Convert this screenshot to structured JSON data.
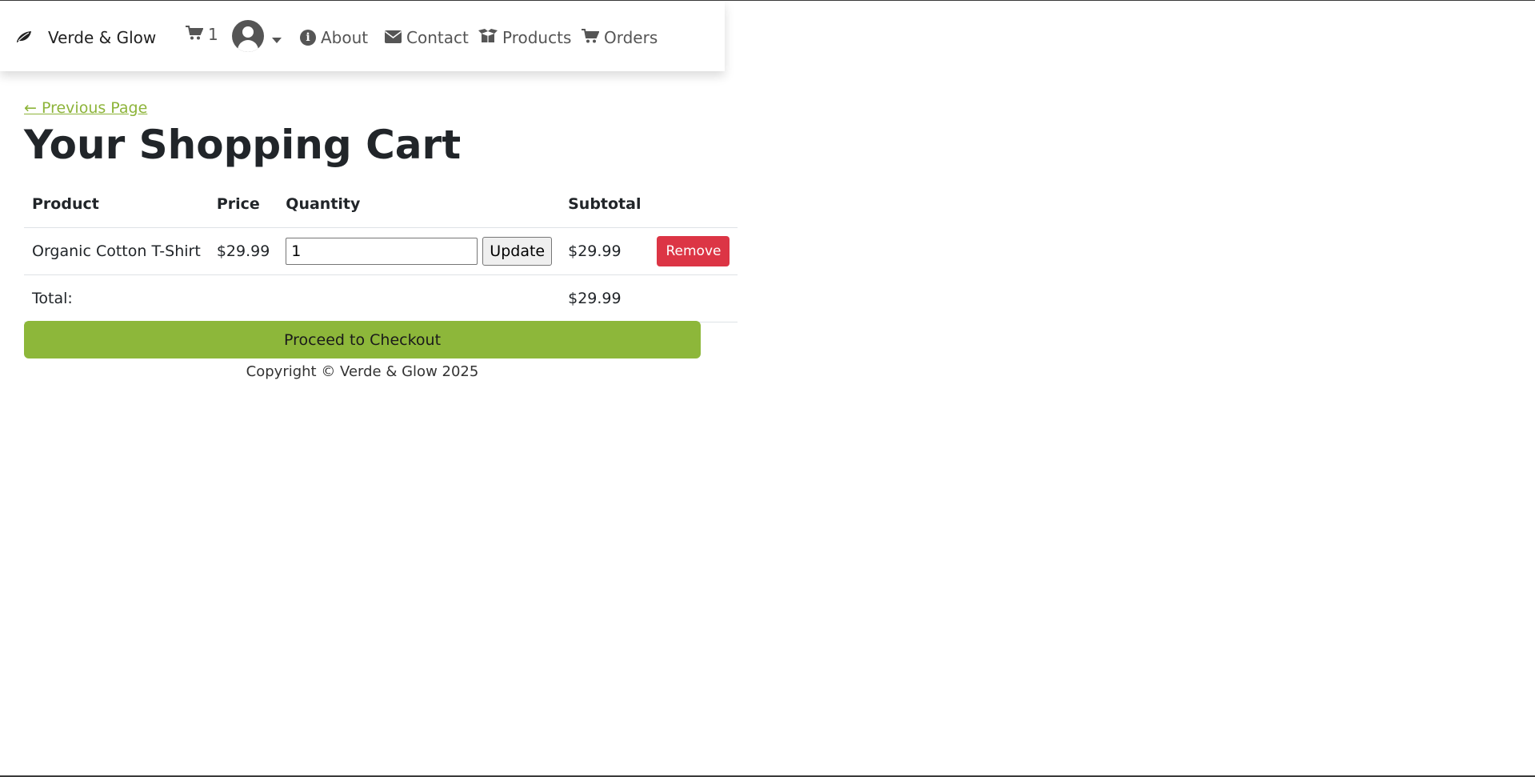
{
  "navbar": {
    "brand": "Verde & Glow",
    "cart_count": "1",
    "links": {
      "about": "About",
      "contact": "Contact",
      "products": "Products",
      "orders": "Orders"
    },
    "icons": {
      "brand": "leaf-icon",
      "cart": "cart-icon",
      "user": "user-avatar-icon",
      "about": "info-icon",
      "contact": "envelope-icon",
      "products": "box-open-icon",
      "orders": "cart-icon"
    }
  },
  "main": {
    "back_link": "← Previous Page",
    "title": "Your Shopping Cart",
    "table": {
      "headers": [
        "Product",
        "Price",
        "Quantity",
        "Subtotal",
        ""
      ],
      "rows": [
        {
          "product": "Organic Cotton T-Shirt",
          "price": "$29.99",
          "quantity": "1",
          "update_label": "Update",
          "subtotal": "$29.99",
          "remove_label": "Remove"
        }
      ],
      "total_label": "Total:",
      "total_value": "$29.99"
    },
    "checkout_label": "Proceed to Checkout"
  },
  "footer": {
    "copyright": "Copyright © Verde & Glow 2025"
  },
  "colors": {
    "accent_green": "#8db73a",
    "link_green": "#8db43a",
    "danger": "#dc3545",
    "nav_text": "#555555"
  }
}
